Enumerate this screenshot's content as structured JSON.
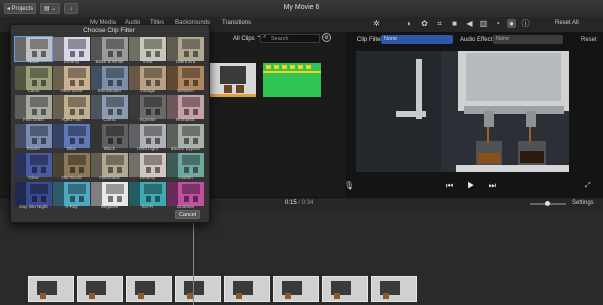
{
  "window": {
    "title": "My Movie 6",
    "projects_button": "◂ Projects"
  },
  "tabs": [
    {
      "label": "My Media"
    },
    {
      "label": "Audio"
    },
    {
      "label": "Titles"
    },
    {
      "label": "Backgrounds"
    },
    {
      "label": "Transitions"
    }
  ],
  "browser": {
    "all_clips": "All Clips ⌃",
    "search_placeholder": "Search"
  },
  "viewer": {
    "reset_all": "Reset All",
    "clip_filter_label": "Clip Filter:",
    "clip_filter_value": "None",
    "audio_effect_label": "Audio Effect:",
    "audio_effect_value": "None",
    "reset": "Reset",
    "controls": "⏮ ▶ ⏭"
  },
  "timeline": {
    "timecode_current": "0:15",
    "timecode_sep": " / ",
    "timecode_total": "0:34",
    "settings": "Settings"
  },
  "dialog": {
    "title": "Choose Clip Filter",
    "cancel": "Cancel",
    "filters": [
      {
        "name": "None",
        "tint": "#bfbfbf",
        "selected": true
      },
      {
        "name": "Dreamy",
        "tint": "#d8d8e8"
      },
      {
        "name": "Black & White",
        "tint": "#9a9a9a"
      },
      {
        "name": "Vivid",
        "tint": "#c8c8b8"
      },
      {
        "name": "Silent Era",
        "tint": "#b0a890"
      },
      {
        "name": "Camo",
        "tint": "#9aa07a"
      },
      {
        "name": "Heat Wave",
        "tint": "#c8b090"
      },
      {
        "name": "Blockbuster",
        "tint": "#7a90a8"
      },
      {
        "name": "Vintage",
        "tint": "#b8a080"
      },
      {
        "name": "Western",
        "tint": "#b08860"
      },
      {
        "name": "Film Grain",
        "tint": "#a8a8a0"
      },
      {
        "name": "Aged Film",
        "tint": "#c0b090"
      },
      {
        "name": "Comic",
        "tint": "#8a9ab0"
      },
      {
        "name": "Vignette",
        "tint": "#6a6a6a"
      },
      {
        "name": "Romantic",
        "tint": "#c8a0a8"
      },
      {
        "name": "Raster",
        "tint": "#7a8ab0"
      },
      {
        "name": "Blue",
        "tint": "#6078b8"
      },
      {
        "name": "Black",
        "tint": "#606060"
      },
      {
        "name": "Hard Light",
        "tint": "#b0b0b8"
      },
      {
        "name": "Bleach Bypass",
        "tint": "#a8b0a8"
      },
      {
        "name": "Glow",
        "tint": "#4a5aa0"
      },
      {
        "name": "Old World",
        "tint": "#8a7858"
      },
      {
        "name": "Flashback",
        "tint": "#b0a890"
      },
      {
        "name": "Dreamy",
        "tint": "#d0c8c0"
      },
      {
        "name": "Hidden",
        "tint": "#70a8a0"
      },
      {
        "name": "Day into Night",
        "tint": "#3a4a90"
      },
      {
        "name": "X-Ray",
        "tint": "#50a8c0"
      },
      {
        "name": "Negative",
        "tint": "#e8e8e8"
      },
      {
        "name": "Sci-Fi",
        "tint": "#40a8b0"
      },
      {
        "name": "Duotone",
        "tint": "#c050a0"
      }
    ]
  }
}
